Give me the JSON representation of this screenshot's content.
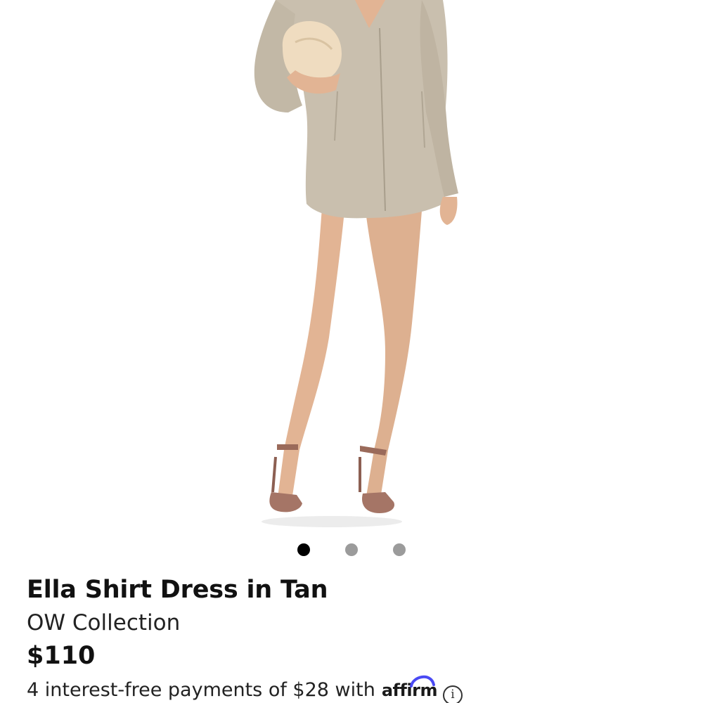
{
  "product": {
    "title": "Ella Shirt Dress in Tan",
    "brand": "OW Collection",
    "price": "$110"
  },
  "gallery": {
    "image_count": 3,
    "active_index": 0,
    "image": "product-photo-model-in-tan-shirt-dress"
  },
  "financing": {
    "text": "4 interest-free payments of $28 with",
    "provider": "affirm",
    "info_icon": "info-icon"
  },
  "colors": {
    "dot_active": "#000000",
    "dot_inactive": "#9b9b9b",
    "dress": "#c9bfae",
    "affirm_arc": "#4a4af4"
  }
}
